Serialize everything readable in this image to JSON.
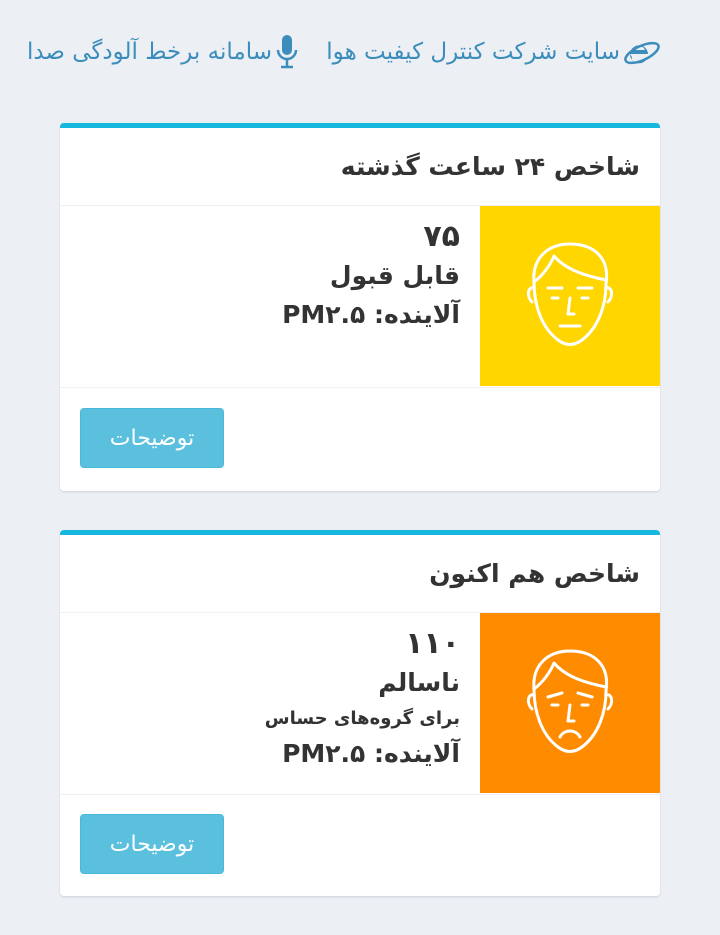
{
  "top_links": {
    "site_label": "سایت شرکت کنترل کیفیت هوا",
    "phone_label": "سامانه برخط آلودگی صدا",
    "site_icon": "internet-explorer-icon",
    "phone_icon": "microphone-icon"
  },
  "cards": [
    {
      "title": "شاخص ۲۴ ساعت گذشته",
      "aqi_value": "۷۵",
      "status": "قابل قبول",
      "sub_status": "",
      "pollutant": "آلاینده: PM۲.۵",
      "face_color": "#ffd600",
      "face_icon": "neutral-face-icon",
      "button_label": "توضیحات"
    },
    {
      "title": "شاخص هم اکنون",
      "aqi_value": "۱۱۰",
      "status": "ناسالم",
      "sub_status": "برای گروه‌های حساس",
      "pollutant": "آلاینده: PM۲.۵",
      "face_color": "#ff8c00",
      "face_icon": "sad-face-icon",
      "button_label": "توضیحات"
    }
  ],
  "colors": {
    "accent": "#17b8e0",
    "link": "#3c8dbc",
    "button": "#5bc0de",
    "background": "#ecf0f5"
  }
}
